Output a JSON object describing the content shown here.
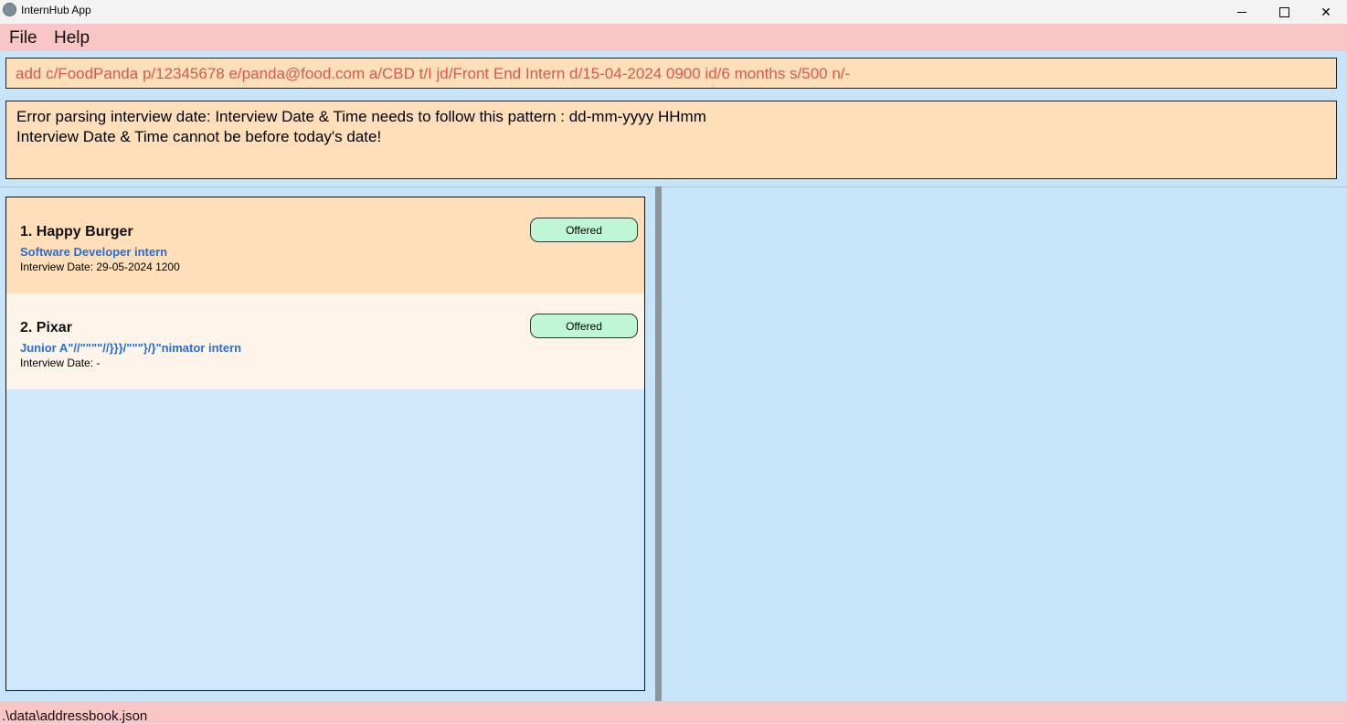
{
  "window": {
    "title": "InternHub App",
    "icon": "app-logo-icon",
    "controls": {
      "minimize": "minimize-icon",
      "maximize": "maximize-icon",
      "close": "✕"
    }
  },
  "menu": {
    "file": "File",
    "help": "Help"
  },
  "command": {
    "value": "add c/FoodPanda p/12345678 e/panda@food.com a/CBD t/I jd/Front End Intern d/15-04-2024 0900 id/6 months s/500 n/-"
  },
  "result": {
    "line1": "Error parsing interview date: Interview Date & Time needs to follow this pattern : dd-mm-yyyy HHmm",
    "line2": "Interview Date & Time cannot be before today's date!"
  },
  "internships": [
    {
      "index": "1.",
      "company": "Happy Burger",
      "title": "1.  Happy Burger",
      "role": "Software Developer intern",
      "interview_date": "Interview Date: 29-05-2024 1200",
      "status": "Offered"
    },
    {
      "index": "2.",
      "company": "Pixar",
      "title": "2.  Pixar",
      "role": "Junior A\"//\"\"\"\"//}}}/\"\"\"}/}\"nimator intern",
      "interview_date": "Interview Date: -",
      "status": "Offered"
    }
  ],
  "statusbar": {
    "path": ".\\data\\addressbook.json"
  },
  "colors": {
    "menubar": "#f9c6c6",
    "panel_bg": "#ffdfb9",
    "command_text": "#d8574f",
    "role_text": "#2a6ed3",
    "status_badge": "#bff6d6",
    "background": "#c8e4f8"
  }
}
